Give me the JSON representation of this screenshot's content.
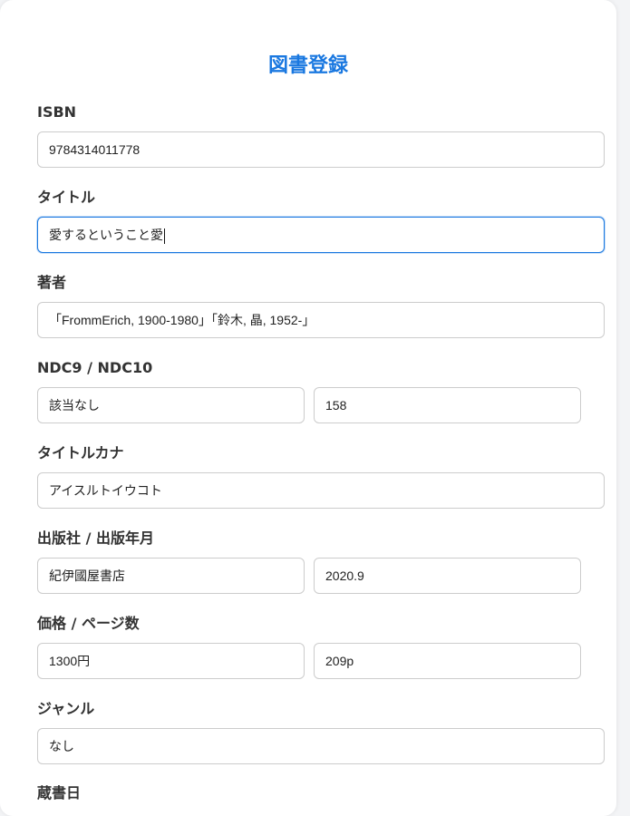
{
  "form": {
    "title": "図書登録",
    "isbn": {
      "label": "ISBN",
      "value": " 9784314011778"
    },
    "title_field": {
      "label": "タイトル",
      "value": "愛するということ愛"
    },
    "author": {
      "label": "著者",
      "value": "「FrommErich, 1900-1980」「鈴木, 晶, 1952-」"
    },
    "ndc": {
      "label": "NDC9 / NDC10",
      "ndc9": "該当なし",
      "ndc10": "158"
    },
    "kana": {
      "label": "タイトルカナ",
      "value": "アイスルトイウコト"
    },
    "publisher": {
      "label": "出版社 / 出版年月",
      "publisher": "紀伊國屋書店",
      "date": "2020.9"
    },
    "price": {
      "label": "価格 / ページ数",
      "price": "1300円",
      "pages": "209p"
    },
    "genre": {
      "label": "ジャンル",
      "value": "なし"
    },
    "acquired": {
      "label": "蔵書日"
    }
  },
  "colors": {
    "accent": "#1a78e0",
    "label": "#333333",
    "border": "#cccccc"
  }
}
